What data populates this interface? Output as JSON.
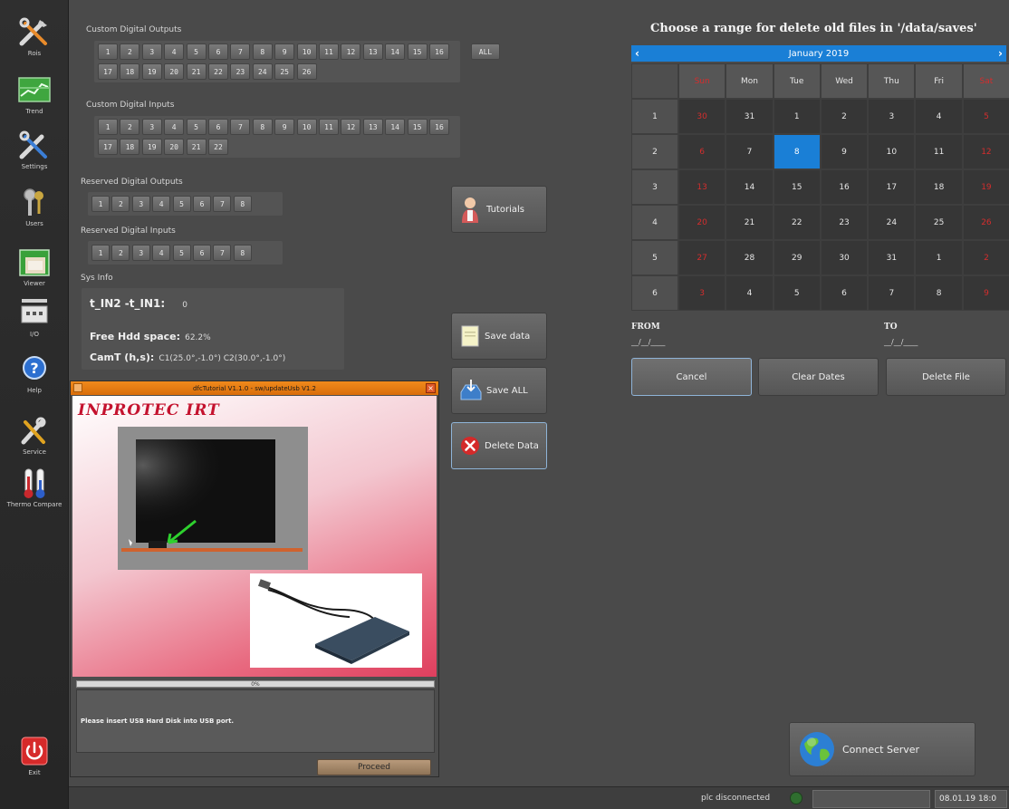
{
  "sidebar": {
    "items": [
      {
        "label": "Rois",
        "icon": "tools-icon"
      },
      {
        "label": "Trend",
        "icon": "trend-icon"
      },
      {
        "label": "Settings",
        "icon": "settings-tools-icon"
      },
      {
        "label": "Users",
        "icon": "users-keys-icon"
      },
      {
        "label": "Viewer",
        "icon": "viewer-icon"
      },
      {
        "label": "I/O",
        "icon": "io-icon"
      },
      {
        "label": "Help",
        "icon": "help-icon"
      },
      {
        "label": "Service",
        "icon": "service-icon"
      },
      {
        "label": "Thermo Compare",
        "icon": "thermometer-icon"
      },
      {
        "label": "Exit",
        "icon": "power-icon"
      }
    ]
  },
  "io": {
    "custom_outputs": {
      "label": "Custom Digital Outputs",
      "row1": [
        "1",
        "2",
        "3",
        "4",
        "5",
        "6",
        "7",
        "8",
        "9",
        "10",
        "11",
        "12",
        "13",
        "14",
        "15",
        "16"
      ],
      "row2": [
        "17",
        "18",
        "19",
        "20",
        "21",
        "22",
        "23",
        "24",
        "25",
        "26"
      ],
      "all_label": "ALL"
    },
    "custom_inputs": {
      "label": "Custom Digital Inputs",
      "row1": [
        "1",
        "2",
        "3",
        "4",
        "5",
        "6",
        "7",
        "8",
        "9",
        "10",
        "11",
        "12",
        "13",
        "14",
        "15",
        "16"
      ],
      "row2": [
        "17",
        "18",
        "19",
        "20",
        "21",
        "22"
      ]
    },
    "reserved_outputs": {
      "label": "Reserved Digital Outputs",
      "row1": [
        "1",
        "2",
        "3",
        "4",
        "5",
        "6",
        "7",
        "8"
      ]
    },
    "reserved_inputs": {
      "label": "Reserved Digital Inputs",
      "row1": [
        "1",
        "2",
        "3",
        "4",
        "5",
        "6",
        "7",
        "8"
      ]
    }
  },
  "sysinfo": {
    "label": "Sys Info",
    "tin_key": "t_IN2 -t_IN1:",
    "tin_val": "0",
    "hdd_key": "Free Hdd space:",
    "hdd_val": "62.2%",
    "camt_key": "CamT (h,s):",
    "camt_val": "C1(25.0°,-1.0°) C2(30.0°,-1.0°)"
  },
  "actions": {
    "tutorials": "Tutorials",
    "save_data": "Save data",
    "save_all": "Save ALL",
    "delete_data": "Delete Data"
  },
  "calendar": {
    "title": "Choose a range for delete old files in '/data/saves'",
    "month_label": "January   2019",
    "weekdays": [
      "Sun",
      "Mon",
      "Tue",
      "Wed",
      "Thu",
      "Fri",
      "Sat"
    ],
    "weeks": [
      {
        "num": "1",
        "days": [
          "30",
          "31",
          "1",
          "2",
          "3",
          "4",
          "5"
        ]
      },
      {
        "num": "2",
        "days": [
          "6",
          "7",
          "8",
          "9",
          "10",
          "11",
          "12"
        ]
      },
      {
        "num": "3",
        "days": [
          "13",
          "14",
          "15",
          "16",
          "17",
          "18",
          "19"
        ]
      },
      {
        "num": "4",
        "days": [
          "20",
          "21",
          "22",
          "23",
          "24",
          "25",
          "26"
        ]
      },
      {
        "num": "5",
        "days": [
          "27",
          "28",
          "29",
          "30",
          "31",
          "1",
          "2"
        ]
      },
      {
        "num": "6",
        "days": [
          "3",
          "4",
          "5",
          "6",
          "7",
          "8",
          "9"
        ]
      }
    ],
    "selected_day": "8",
    "from_label": "FROM",
    "to_label": "TO",
    "from_value": "__/__/____",
    "to_value": "__/__/____",
    "cancel": "Cancel",
    "clear_dates": "Clear Dates",
    "delete_file": "Delete File",
    "weekend_color": "#d42d2d",
    "selected_color": "#1a7fd6"
  },
  "tutorial": {
    "window_title": "dfcTutorial V1.1.0 - sw/updateUsb V1.2",
    "logo": "INPROTEC IRT",
    "progress": "0%",
    "message": "Please insert USB Hard Disk into USB port.",
    "proceed": "Proceed"
  },
  "connect_server": "Connect Server",
  "status": {
    "plc": "plc disconnected",
    "datetime": "08.01.19 18:0"
  }
}
